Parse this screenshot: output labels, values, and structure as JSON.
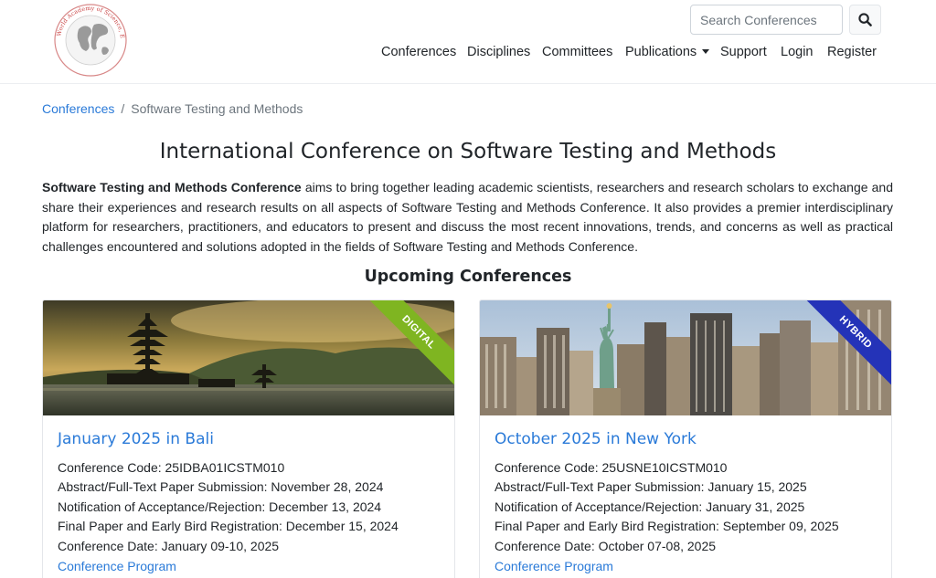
{
  "brand": {
    "logo_text": "World Academy of Science, Engineering and Technology"
  },
  "search": {
    "placeholder": "Search Conferences"
  },
  "nav": {
    "conferences": "Conferences",
    "disciplines": "Disciplines",
    "committees": "Committees",
    "publications": "Publications",
    "support": "Support",
    "login": "Login",
    "register": "Register"
  },
  "breadcrumb": {
    "root": "Conferences",
    "separator": "/",
    "current": "Software Testing and Methods"
  },
  "page": {
    "title": "International Conference on Software Testing and Methods",
    "intro_bold": "Software Testing and Methods Conference",
    "intro_rest": " aims to bring together leading academic scientists, researchers and research scholars to exchange and share their experiences and research results on all aspects of Software Testing and Methods Conference. It also provides a premier interdisciplinary platform for researchers, practitioners, and educators to present and discuss the most recent innovations, trends, and concerns as well as practical challenges encountered and solutions adopted in the fields of Software Testing and Methods Conference.",
    "upcoming_heading": "Upcoming Conferences"
  },
  "cards": [
    {
      "ribbon": "DIGITAL",
      "ribbon_color": "#7fb521",
      "title": "January 2025 in Bali",
      "code": "Conference Code: 25IDBA01ICSTM010",
      "abstract": "Abstract/Full-Text Paper Submission: November 28, 2024",
      "notification": "Notification of Acceptance/Rejection: December 13, 2024",
      "final": "Final Paper and Early Bird Registration: December 15, 2024",
      "date": "Conference Date: January 09-10, 2025",
      "program": "Conference Program"
    },
    {
      "ribbon": "HYBRID",
      "ribbon_color": "#2433b8",
      "title": "October 2025 in New York",
      "code": "Conference Code: 25USNE10ICSTM010",
      "abstract": "Abstract/Full-Text Paper Submission: January 15, 2025",
      "notification": "Notification of Acceptance/Rejection: January 31, 2025",
      "final": "Final Paper and Early Bird Registration: September 09, 2025",
      "date": "Conference Date: October 07-08, 2025",
      "program": "Conference Program"
    }
  ],
  "colors": {
    "link": "#2a7ad8",
    "text": "#212529",
    "muted": "#6c757d",
    "logo_red": "#c94141"
  }
}
